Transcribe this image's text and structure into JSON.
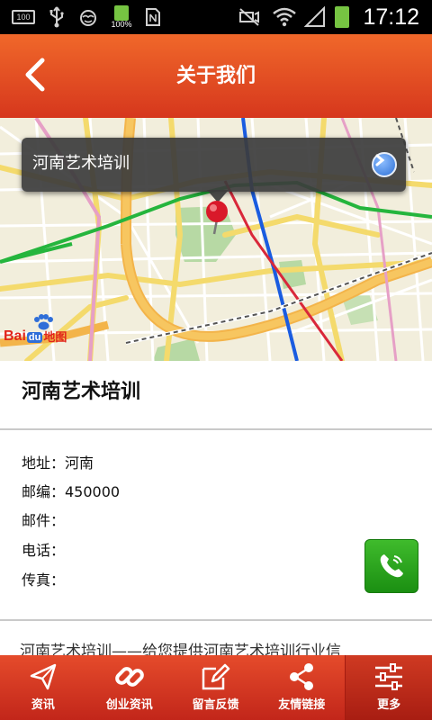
{
  "status_bar": {
    "battery_left_label": "100",
    "charge_percent": "100%",
    "time": "17:12"
  },
  "header": {
    "title": "关于我们"
  },
  "map": {
    "popup_label": "河南艺术培训",
    "logo_bai": "Bai",
    "logo_du": "du",
    "logo_ditu": "地图"
  },
  "org": {
    "name": "河南艺术培训"
  },
  "contact": {
    "address": "地址：河南",
    "postcode": "邮编：450000",
    "email": "邮件：",
    "phone": "电话：",
    "fax": "传真："
  },
  "intro": {
    "text": "河南艺术培训——给您提供河南艺术培训行业信"
  },
  "bottom_nav": [
    {
      "label": "资讯",
      "icon": "paper-plane-icon",
      "active": false
    },
    {
      "label": "创业资讯",
      "icon": "link-icon",
      "active": false
    },
    {
      "label": "留言反馈",
      "icon": "edit-icon",
      "active": false
    },
    {
      "label": "友情链接",
      "icon": "share-icon",
      "active": false
    },
    {
      "label": "更多",
      "icon": "settings-sliders-icon",
      "active": true
    }
  ],
  "colors": {
    "header_red": "#e0451f",
    "call_green": "#2aa51d",
    "map_pin": "#d9192a"
  }
}
